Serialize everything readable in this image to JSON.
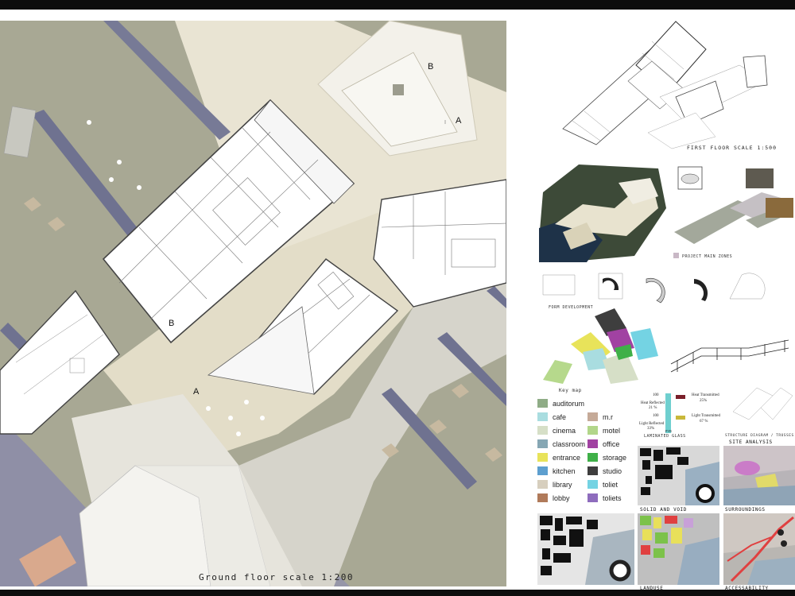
{
  "titles": {
    "ground_floor": "Ground floor scale 1:200",
    "first_floor": "FIRST FLOOR SCALE 1:500"
  },
  "section_markers": {
    "a_top": "A",
    "b_top": "B",
    "b_bottom": "B",
    "a_bottom": "A"
  },
  "captions": {
    "project_main_zones": "PROJECT MAIN ZONES",
    "form_development": "FORM DEVELOPMENT",
    "key_map": "Key map",
    "laminated_glass": "LAMINATED GLASS",
    "structure": "STRUCTURE DIAGRAM / TRUSSES",
    "site_analysis": "SITE ANALYSIS",
    "solid_and_void": "SOLID AND VOID",
    "surroundings": "SURROUNDINGS",
    "landuse": "LANDUSE",
    "accessability": "ACCESSABILITY"
  },
  "glass_diagram": {
    "v100_left": "100",
    "v100_right": "100",
    "heat_transmitted": "Heat Transmitted",
    "heat_transmitted_pct": "25%",
    "heat_reflected": "Heat Reflected",
    "heat_reflected_pct": "21 %",
    "light_reflected": "Light Reflected",
    "light_reflected_pct": "33%",
    "light_transmitted": "Light Transmitted",
    "light_transmitted_pct": "67 %",
    "pvb": "PVB"
  },
  "legend": [
    {
      "label": "auditorum",
      "color": "#8fac86"
    },
    {
      "label": "cafe",
      "color": "#a9dde0"
    },
    {
      "label": "cinema",
      "color": "#d6dfc7"
    },
    {
      "label": "classroom",
      "color": "#86a7b4"
    },
    {
      "label": "entrance",
      "color": "#e8e35a"
    },
    {
      "label": "kitchen",
      "color": "#5d9fcf"
    },
    {
      "label": "library",
      "color": "#d7cfbe"
    },
    {
      "label": "lobby",
      "color": "#b07a5a"
    },
    {
      "label": "m.r",
      "color": "#c5aa98"
    },
    {
      "label": "motel",
      "color": "#b2d68a"
    },
    {
      "label": "office",
      "color": "#a142a2"
    },
    {
      "label": "storage",
      "color": "#3fb048"
    },
    {
      "label": "studio",
      "color": "#3e3e3e"
    },
    {
      "label": "toliet",
      "color": "#74d3e3"
    },
    {
      "label": "toliets",
      "color": "#8e6cbd"
    }
  ]
}
